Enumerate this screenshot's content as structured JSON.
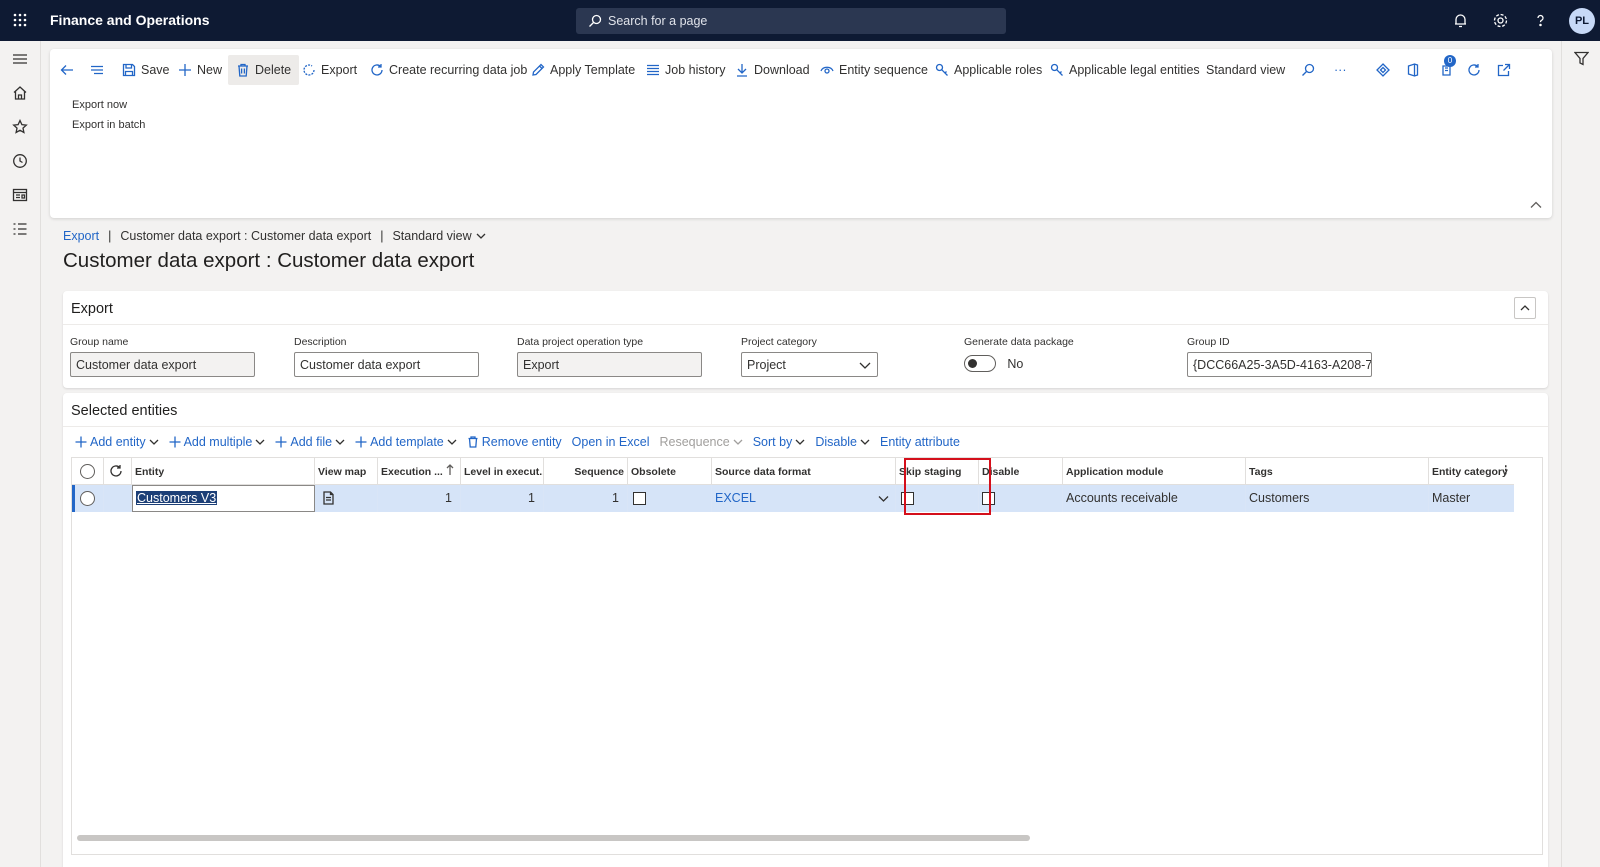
{
  "topbar": {
    "app_title": "Finance and Operations",
    "search_placeholder": "Search for a page",
    "avatar_initials": "PL"
  },
  "action_pane": {
    "save": "Save",
    "new": "New",
    "delete": "Delete",
    "export": "Export",
    "create_recurring": "Create recurring data job",
    "apply_template": "Apply Template",
    "job_history": "Job history",
    "download": "Download",
    "entity_sequence": "Entity sequence",
    "applicable_roles": "Applicable roles",
    "applicable_legal_entities": "Applicable legal entities",
    "standard_view": "Standard view",
    "more": "···",
    "badge_count": "0",
    "export_now": "Export now",
    "export_in_batch": "Export in batch"
  },
  "breadcrumb": {
    "root": "Export",
    "page": "Customer data export : Customer data export",
    "view": "Standard view"
  },
  "page_title": "Customer data export : Customer data export",
  "export_section": {
    "header": "Export",
    "group_name": {
      "label": "Group name",
      "value": "Customer data export"
    },
    "description": {
      "label": "Description",
      "value": "Customer data export"
    },
    "operation_type": {
      "label": "Data project operation type",
      "value": "Export"
    },
    "project_category": {
      "label": "Project category",
      "value": "Project"
    },
    "generate_package": {
      "label": "Generate data package",
      "value": "No"
    },
    "group_id": {
      "label": "Group ID",
      "value": "{DCC66A25-3A5D-4163-A208-7..."
    }
  },
  "entities_section": {
    "header": "Selected entities",
    "toolbar": {
      "add_entity": "Add entity",
      "add_multiple": "Add multiple",
      "add_file": "Add file",
      "add_template": "Add template",
      "remove_entity": "Remove entity",
      "open_in_excel": "Open in Excel",
      "resequence": "Resequence",
      "sort_by": "Sort by",
      "disable": "Disable",
      "entity_attribute": "Entity attribute"
    },
    "columns": {
      "entity": "Entity",
      "view_map": "View map",
      "execution": "Execution ...",
      "level": "Level in execut...",
      "sequence": "Sequence",
      "obsolete": "Obsolete",
      "source_format": "Source data format",
      "skip_staging": "Skip staging",
      "disable": "Disable",
      "app_module": "Application module",
      "tags": "Tags",
      "entity_category": "Entity category"
    },
    "rows": [
      {
        "entity": "Customers V3",
        "execution": "1",
        "level": "1",
        "sequence": "1",
        "obsolete": false,
        "source_format": "EXCEL",
        "skip_staging": false,
        "disable": false,
        "app_module": "Accounts receivable",
        "tags": "Customers",
        "entity_category": "Master"
      }
    ]
  }
}
